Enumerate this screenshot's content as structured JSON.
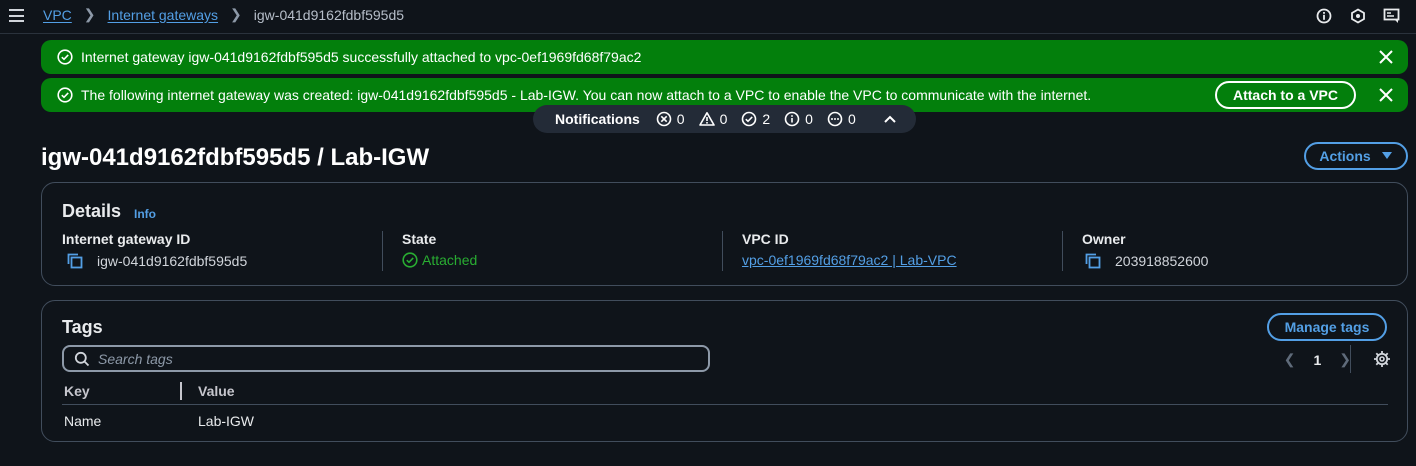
{
  "breadcrumb": {
    "items": [
      "VPC",
      "Internet gateways"
    ],
    "current": "igw-041d9162fdbf595d5"
  },
  "flashes": [
    {
      "message": "Internet gateway igw-041d9162fdbf595d5 successfully attached to vpc-0ef1969fd68f79ac2"
    },
    {
      "message": "The following internet gateway was created: igw-041d9162fdbf595d5 - Lab-IGW. You can now attach to a VPC to enable the VPC to communicate with the internet.",
      "action_label": "Attach to a VPC"
    }
  ],
  "notifications": {
    "title": "Notifications",
    "error": "0",
    "warning": "0",
    "success": "2",
    "info": "0",
    "in_progress": "0"
  },
  "page": {
    "title": "igw-041d9162fdbf595d5 / Lab-IGW",
    "actions_label": "Actions"
  },
  "details": {
    "header": "Details",
    "info_label": "Info",
    "gateway_id_label": "Internet gateway ID",
    "gateway_id": "igw-041d9162fdbf595d5",
    "state_label": "State",
    "state": "Attached",
    "vpc_id_label": "VPC ID",
    "vpc_id": "vpc-0ef1969fd68f79ac2 | Lab-VPC",
    "owner_label": "Owner",
    "owner": "203918852600"
  },
  "tags": {
    "header": "Tags",
    "manage_label": "Manage tags",
    "search_placeholder": "Search tags",
    "page": "1",
    "columns": [
      "Key",
      "Value"
    ],
    "rows": [
      {
        "key": "Name",
        "value": "Lab-IGW"
      }
    ]
  },
  "colors": {
    "success": "#037f0c",
    "link": "#539fe5",
    "background": "#0f141a"
  }
}
